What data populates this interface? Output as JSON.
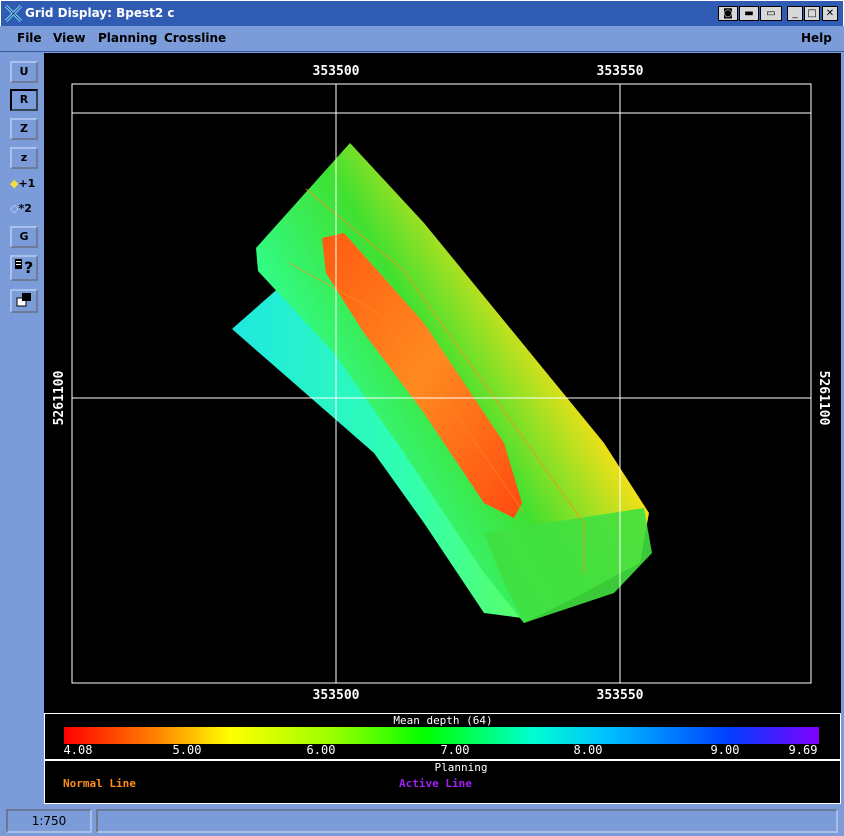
{
  "window": {
    "title": "Grid Display: Bpest2 c"
  },
  "menu": {
    "file": "File",
    "view": "View",
    "planning": "Planning",
    "crossline": "Crossline",
    "help": "Help"
  },
  "toolbar": {
    "u": "U",
    "r": "R",
    "z_upper": "Z",
    "z_lower": "z",
    "plus1": "+1",
    "star2": "*2",
    "g": "G"
  },
  "plot": {
    "x_tick_1": "353500",
    "x_tick_2": "353550",
    "y_tick": "5261100"
  },
  "colorbar": {
    "title": "Mean depth (64)",
    "ticks": [
      "4.08",
      "5.00",
      "6.00",
      "7.00",
      "8.00",
      "9.00",
      "9.69"
    ]
  },
  "planning": {
    "title": "Planning",
    "normal_line": "Normal Line",
    "active_line": "Active Line",
    "normal_color": "#ff8c1a",
    "active_color": "#a020f0"
  },
  "status": {
    "scale": "1:750",
    "message": ""
  }
}
